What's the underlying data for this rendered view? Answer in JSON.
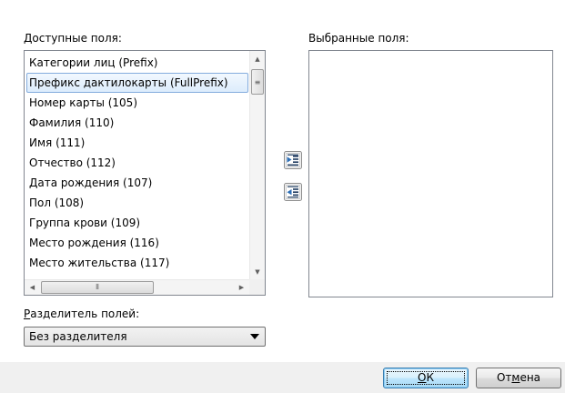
{
  "available": {
    "label": "Доступные поля:",
    "items": [
      "Категории лиц (Prefix)",
      "Префикс дактилокарты (FullPrefix)",
      "Номер карты (105)",
      "Фамилия (110)",
      "Имя (111)",
      "Отчество (112)",
      "Дата рождения (107)",
      "Пол (108)",
      "Группа крови (109)",
      "Место рождения (116)",
      "Место жительства (117)"
    ],
    "selected_index": 1
  },
  "selected": {
    "label": "Выбранные поля:",
    "items": []
  },
  "separator": {
    "label_first": "Р",
    "label_rest": "азделитель полей:",
    "value": "Без разделителя"
  },
  "buttons": {
    "ok_first": "О",
    "ok_rest": "К",
    "cancel_pre": "От",
    "cancel_u": "м",
    "cancel_post": "ена"
  },
  "icons": {
    "add": "add-field-icon",
    "remove": "remove-field-icon"
  }
}
